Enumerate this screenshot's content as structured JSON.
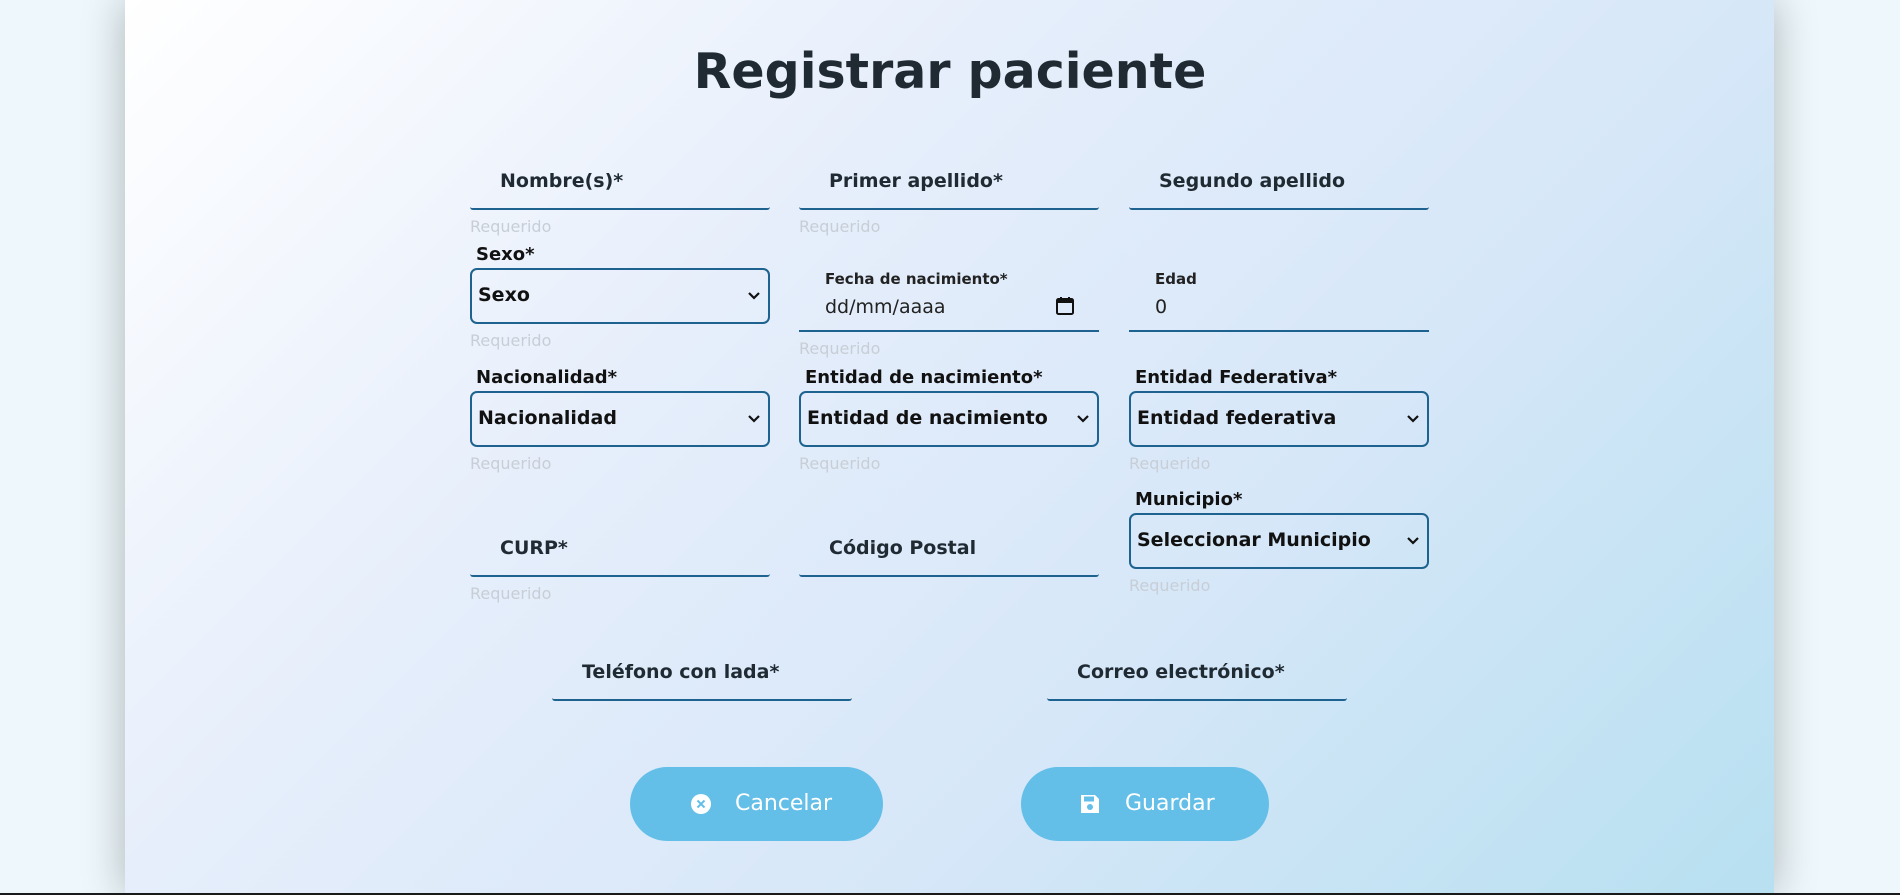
{
  "title": "Registrar paciente",
  "required_text": "Requerido",
  "fields": {
    "nombre": {
      "label": "Nombre(s)*"
    },
    "primer_apellido": {
      "label": "Primer apellido*"
    },
    "segundo_apellido": {
      "label": "Segundo apellido"
    },
    "sexo": {
      "label": "Sexo*",
      "value": "Sexo"
    },
    "fecha_nacimiento": {
      "label": "Fecha de nacimiento*",
      "value": "dd/mm/aaaa"
    },
    "edad": {
      "label": "Edad",
      "value": "0"
    },
    "nacionalidad": {
      "label": "Nacionalidad*",
      "value": "Nacionalidad"
    },
    "entidad_nacimiento": {
      "label": "Entidad de nacimiento*",
      "value": "Entidad de nacimiento"
    },
    "entidad_federativa": {
      "label": "Entidad Federativa*",
      "value": "Entidad federativa"
    },
    "curp": {
      "label": "CURP*"
    },
    "codigo_postal": {
      "label": "Código Postal"
    },
    "municipio": {
      "label": "Municipio*",
      "value": "Seleccionar Municipio"
    },
    "telefono": {
      "label": "Teléfono con lada*"
    },
    "correo": {
      "label": "Correo electrónico*"
    }
  },
  "buttons": {
    "cancel": {
      "label": "Cancelar",
      "icon": "close-circle-icon"
    },
    "save": {
      "label": "Guardar",
      "icon": "floppy-disk-icon"
    }
  },
  "colors": {
    "accent_border": "#1e6390",
    "button_bg": "#63bfe8",
    "required_text": "#c8ced6"
  }
}
